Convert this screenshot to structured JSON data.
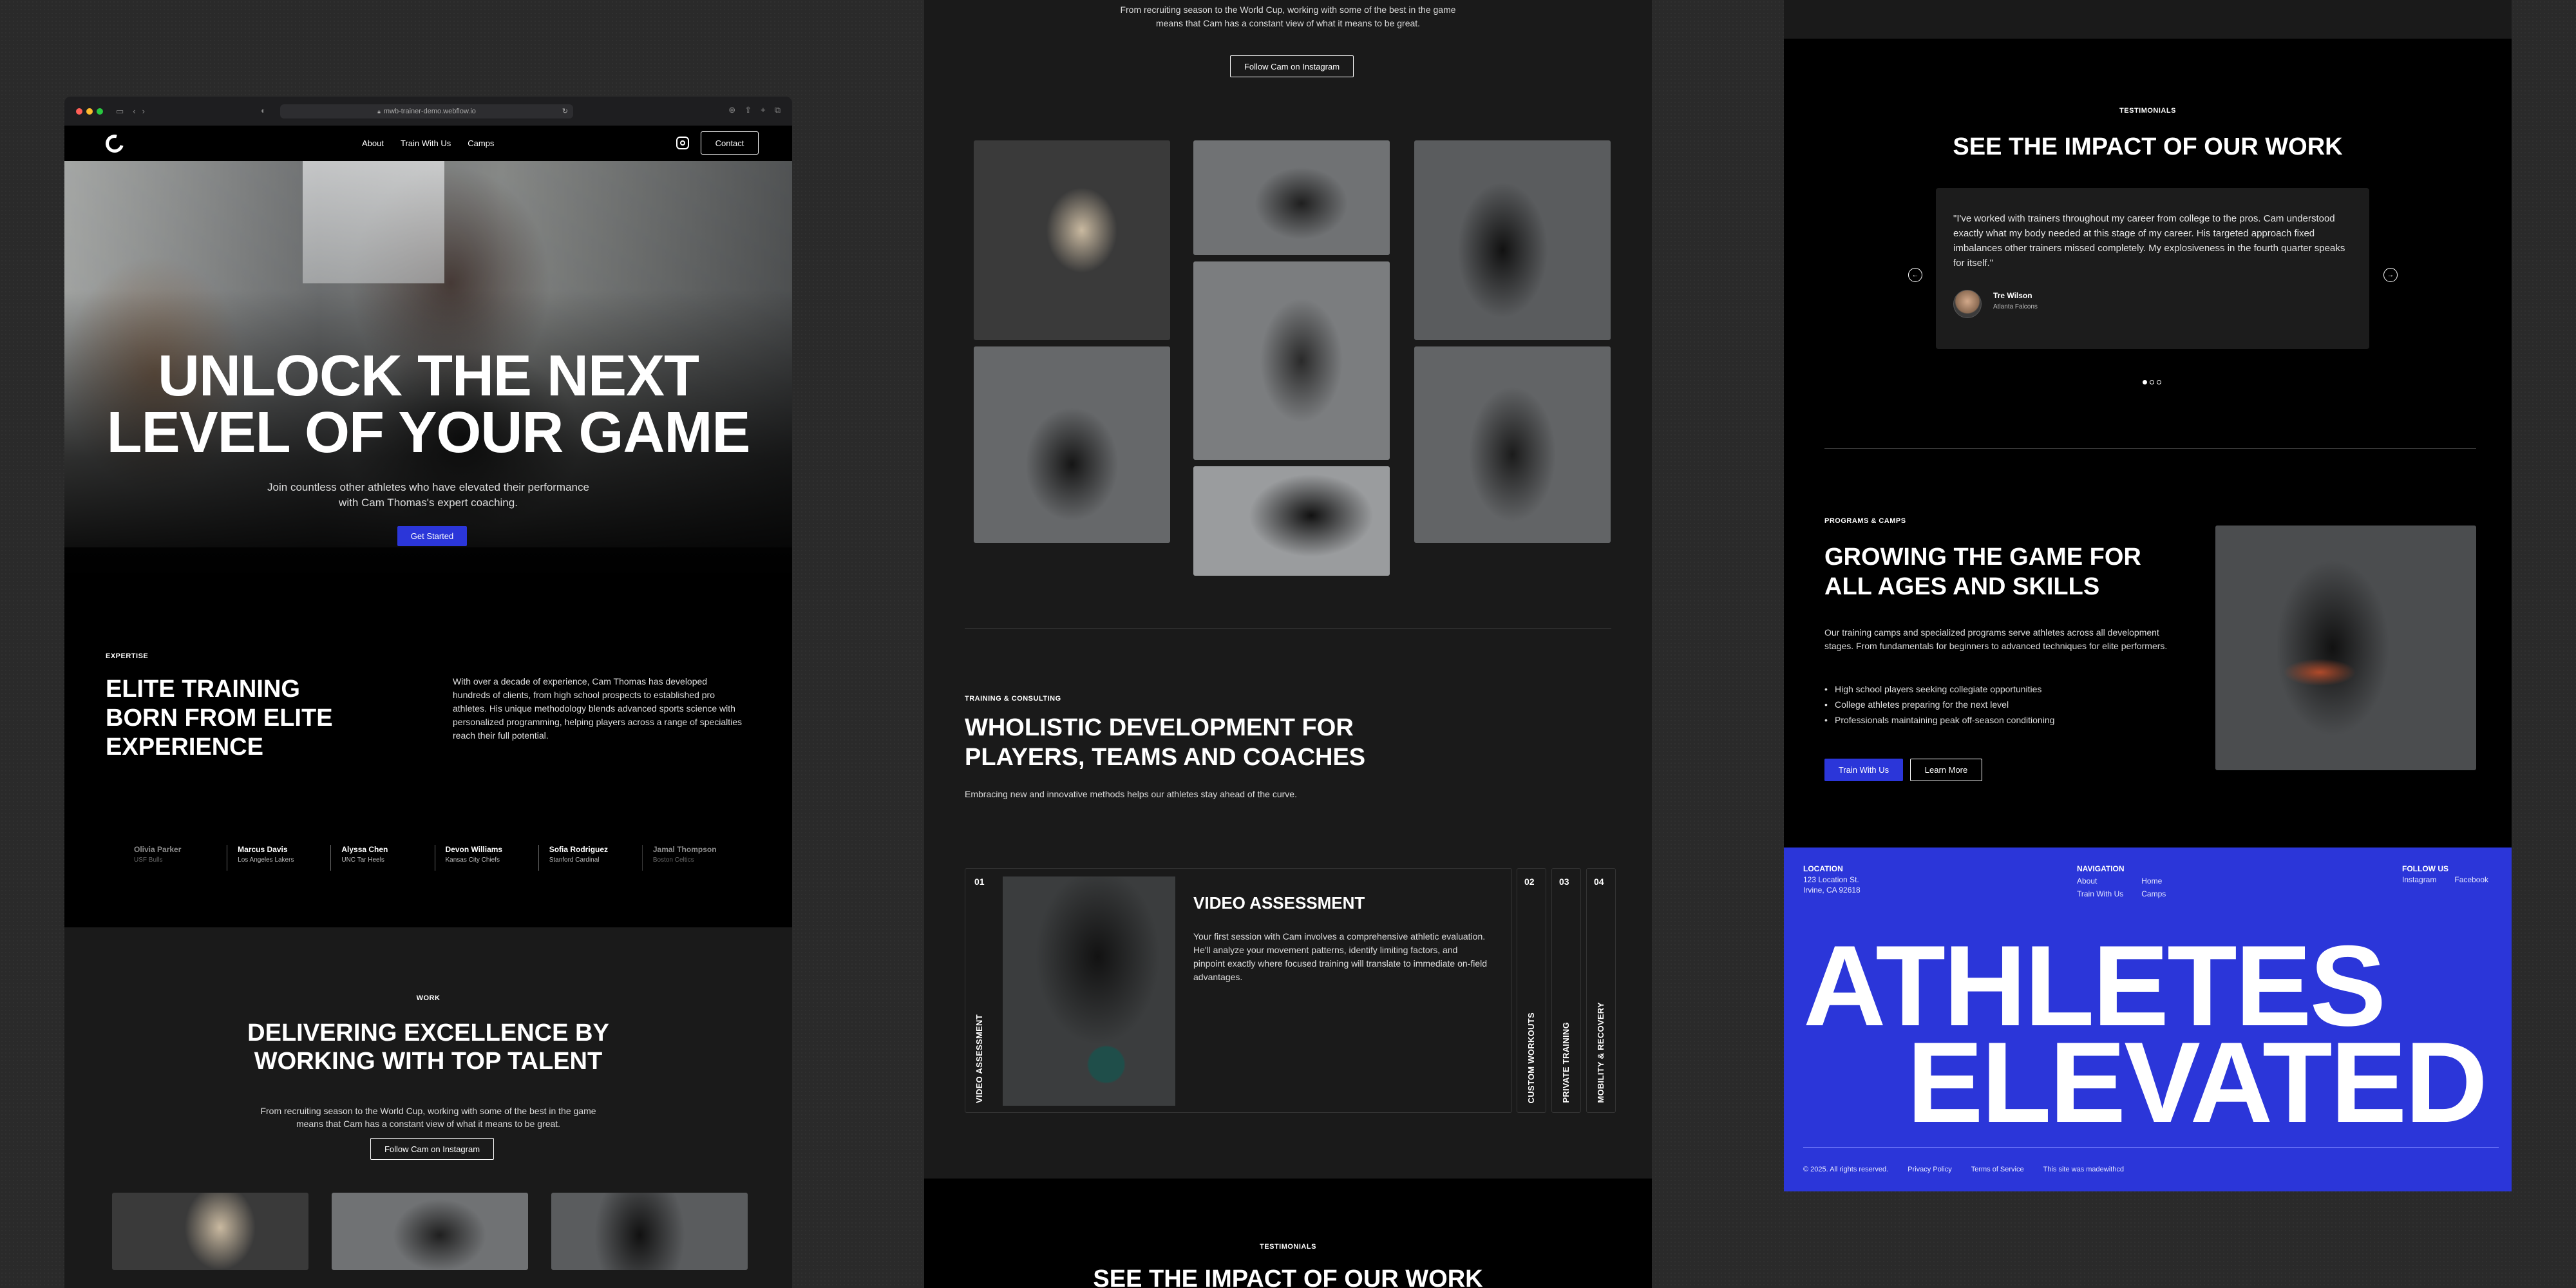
{
  "browser": {
    "url": "mwb-trainer-demo.webflow.io"
  },
  "nav": {
    "links": [
      "About",
      "Train With Us",
      "Camps"
    ],
    "contact": "Contact"
  },
  "hero": {
    "title_line1": "UNLOCK THE NEXT",
    "title_line2": "LEVEL OF YOUR GAME",
    "sub_line1": "Join countless other athletes who have elevated their performance",
    "sub_line2": "with Cam Thomas's expert coaching.",
    "cta": "Get Started"
  },
  "expertise": {
    "eyebrow": "EXPERTISE",
    "title_line1": "ELITE TRAINING",
    "title_line2": "BORN FROM ELITE",
    "title_line3": "EXPERIENCE",
    "body": "With over a decade of experience, Cam Thomas has developed hundreds of clients, from high school prospects to established pro athletes. His unique methodology blends advanced sports science with personalized programming, helping players across a range of specialties reach their full potential.",
    "clients": [
      {
        "name": "Olivia Parker",
        "team": "USF Bulls"
      },
      {
        "name": "Marcus Davis",
        "team": "Los Angeles Lakers"
      },
      {
        "name": "Alyssa Chen",
        "team": "UNC Tar Heels"
      },
      {
        "name": "Devon Williams",
        "team": "Kansas City Chiefs"
      },
      {
        "name": "Sofia Rodriguez",
        "team": "Stanford Cardinal"
      },
      {
        "name": "Jamal Thompson",
        "team": "Boston Celtics"
      }
    ]
  },
  "work": {
    "eyebrow": "WORK",
    "title_line1": "DELIVERING EXCELLENCE BY",
    "title_line2": "WORKING WITH TOP TALENT",
    "sub_line1": "From recruiting season to the World Cup, working with some of the best in the game",
    "sub_line2": "means that Cam has a constant view of what it means to be great.",
    "cta": "Follow Cam on Instagram"
  },
  "training": {
    "eyebrow": "TRAINING & CONSULTING",
    "title_line1": "WHOLISTIC DEVELOPMENT FOR",
    "title_line2": "PLAYERS, TEAMS AND COACHES",
    "sub": "Embracing new and innovative methods helps our athletes stay ahead of the curve.",
    "services": [
      {
        "num": "01",
        "label": "VIDEO ASSESSMENT"
      },
      {
        "num": "02",
        "label": "CUSTOM WORKOUTS"
      },
      {
        "num": "03",
        "label": "PRIVATE TRAINING"
      },
      {
        "num": "04",
        "label": "MOBILITY & RECOVERY"
      }
    ],
    "active_title": "VIDEO ASSESSMENT",
    "active_body": "Your first session with Cam involves a comprehensive athletic evaluation. He'll analyze your movement patterns, identify limiting factors, and pinpoint exactly where focused training will translate to immediate on-field advantages."
  },
  "testimonials": {
    "eyebrow": "TESTIMONIALS",
    "title": "SEE THE IMPACT OF OUR WORK",
    "title_cropped": "SEE THE IMPACT OF OUR WORK",
    "quote": "\"I've worked with trainers throughout my career from college to the pros. Cam understood exactly what my body needed at this stage of my career. His targeted approach fixed imbalances other trainers missed completely. My explosiveness in the fourth quarter speaks for itself.\"",
    "name": "Tre Wilson",
    "team": "Atlanta Falcons",
    "slide_count": 3,
    "active_slide": 1
  },
  "programs": {
    "eyebrow": "PROGRAMS & CAMPS",
    "title_line1": "GROWING THE GAME FOR",
    "title_line2": "ALL AGES AND SKILLS",
    "body": "Our training camps and specialized programs serve athletes across all development stages. From fundamentals for beginners to advanced techniques for elite performers.",
    "list": [
      "High school players seeking collegiate opportunities",
      "College athletes preparing for the next level",
      "Professionals maintaining peak off-season conditioning"
    ],
    "cta_primary": "Train With Us",
    "cta_secondary": "Learn More"
  },
  "footer": {
    "location_label": "LOCATION",
    "address_line1": "123 Location St.",
    "address_line2": "Irvine, CA 92618",
    "nav_label": "NAVIGATION",
    "nav_links": [
      "Home",
      "About",
      "Camps",
      "Train With Us"
    ],
    "follow_label": "FOLLOW US",
    "social": [
      "Instagram",
      "Facebook"
    ],
    "big_line1": "ATHLETES",
    "big_line2": "ELEVATED",
    "copyright": "© 2025. All rights reserved.",
    "privacy": "Privacy Policy",
    "terms": "Terms of Service",
    "made": "This site was madewithcd"
  },
  "colors": {
    "accent": "#2b36d9",
    "page_bg": "#2a2a2a",
    "section_dark": "#000000",
    "section_gray": "#1a1a1a"
  }
}
